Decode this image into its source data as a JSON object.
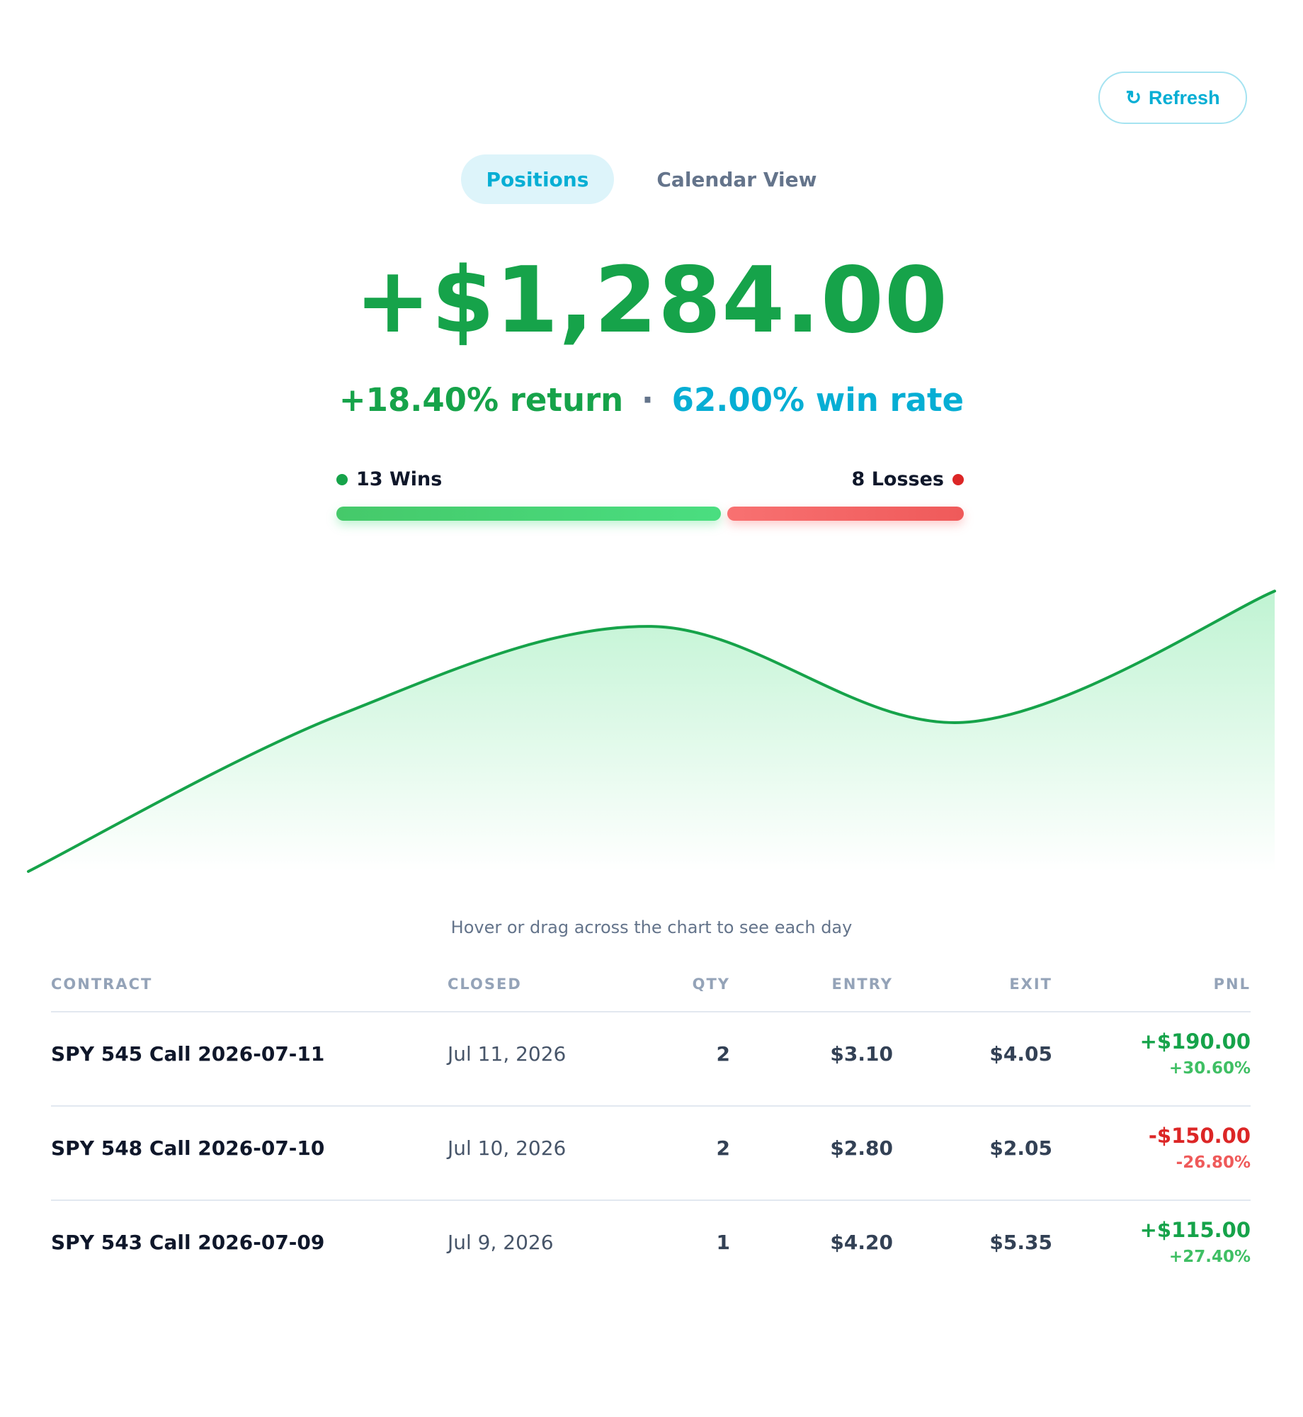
{
  "toolbar": {
    "refresh_icon": "↻",
    "refresh_label": "Refresh"
  },
  "tabs": [
    {
      "label": "Positions",
      "active": true
    },
    {
      "label": "Calendar View",
      "active": false
    }
  ],
  "summary": {
    "total_pnl": "+$1,284.00",
    "return_text": "+18.40% return",
    "separator": "·",
    "win_rate_text": "62.00% win rate"
  },
  "win_loss": {
    "wins_label": "13 Wins",
    "losses_label": "8 Losses",
    "wins": 13,
    "losses": 8
  },
  "colors": {
    "positive": "#16a34a",
    "negative": "#dc2626",
    "accent": "#06aed4"
  },
  "chart_data": {
    "type": "area",
    "series": [
      {
        "values": [
          0.0,
          0.62,
          0.97,
          0.59,
          1.11
        ]
      }
    ],
    "ylim": [
      0,
      1.15
    ]
  },
  "hint": "Hover or drag across the chart to see each day",
  "table": {
    "headers": {
      "contract": "CONTRACT",
      "closed": "CLOSED",
      "qty": "QTY",
      "entry": "ENTRY",
      "exit": "EXIT",
      "pnl": "PNL"
    },
    "rows": [
      {
        "contract": "SPY 545 Call 2026-07-11",
        "closed": "Jul 11, 2026",
        "qty": "2",
        "entry": "$3.10",
        "exit": "$4.05",
        "pnl": "+$190.00",
        "pnl_pct": "+30.60%",
        "positive": true
      },
      {
        "contract": "SPY 548 Call 2026-07-10",
        "closed": "Jul 10, 2026",
        "qty": "2",
        "entry": "$2.80",
        "exit": "$2.05",
        "pnl": "-$150.00",
        "pnl_pct": "-26.80%",
        "positive": false
      },
      {
        "contract": "SPY 543 Call 2026-07-09",
        "closed": "Jul 9, 2026",
        "qty": "1",
        "entry": "$4.20",
        "exit": "$5.35",
        "pnl": "+$115.00",
        "pnl_pct": "+27.40%",
        "positive": true
      }
    ]
  }
}
